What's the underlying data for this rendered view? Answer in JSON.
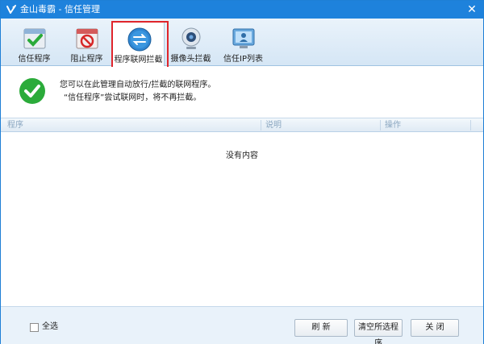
{
  "window": {
    "title": "金山毒霸 - 信任管理",
    "close_glyph": "✕"
  },
  "tabs": [
    {
      "label": "信任程序",
      "icon": "trusted-program-icon"
    },
    {
      "label": "阻止程序",
      "icon": "blocked-program-icon"
    },
    {
      "label": "程序联网拦截",
      "icon": "network-intercept-icon",
      "active": true
    },
    {
      "label": "摄像头拦截",
      "icon": "webcam-icon"
    },
    {
      "label": "信任IP列表",
      "icon": "trusted-ip-icon"
    }
  ],
  "info": {
    "line1": "您可以在此管理自动放行/拦截的联网程序。",
    "line2": "“信任程序”尝试联网时，将不再拦截。"
  },
  "list": {
    "columns": [
      "程序",
      "说明",
      "操作"
    ],
    "empty_text": "没有内容"
  },
  "footer": {
    "select_all": "全选",
    "refresh": "刷 新",
    "clear_selected": "清空所选程序",
    "close": "关 闭"
  },
  "colors": {
    "titlebar": "#1e82dc",
    "highlight": "#e0252b",
    "ok_green": "#2bab3a"
  }
}
